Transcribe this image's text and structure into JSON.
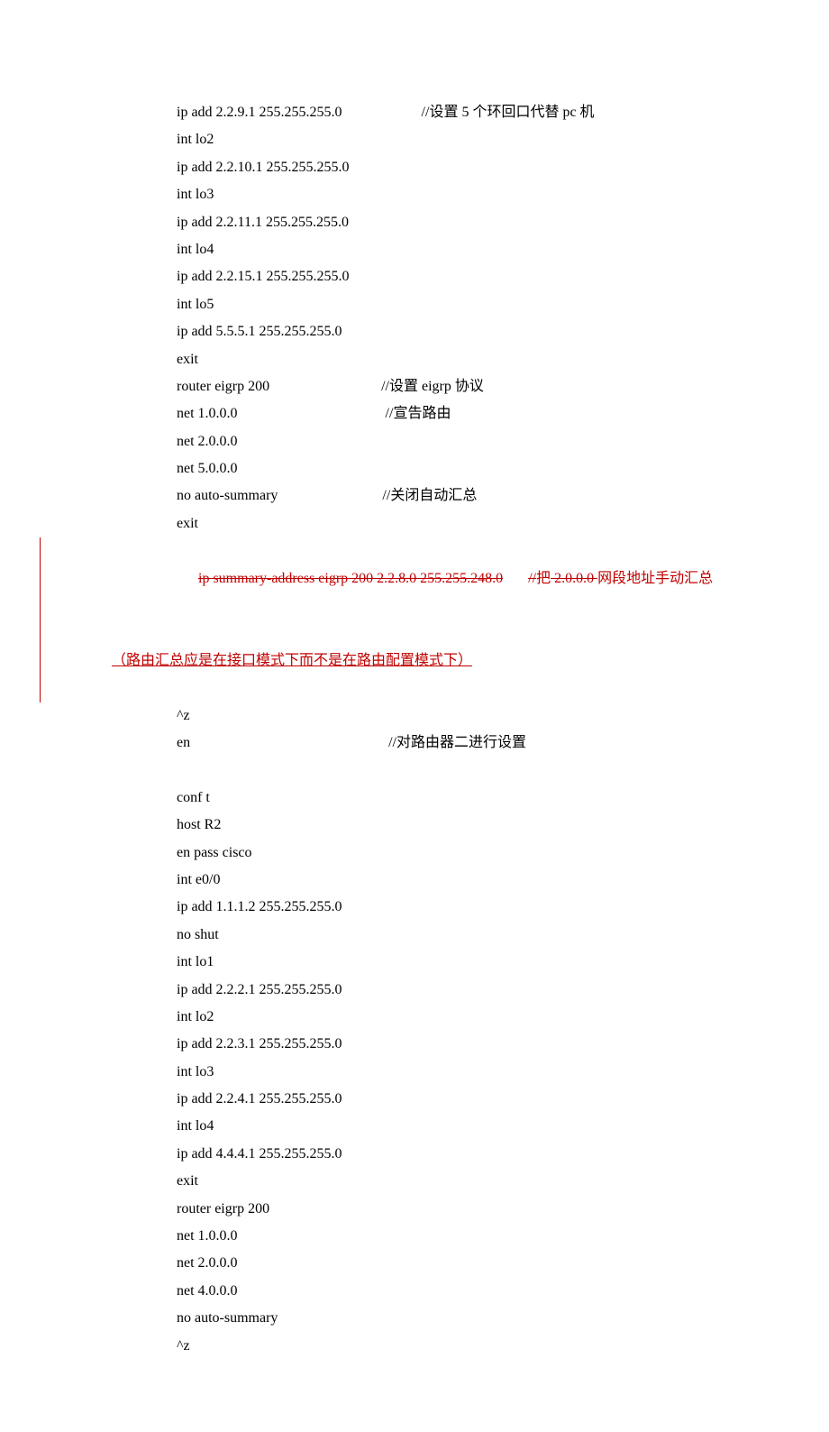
{
  "lines": [
    {
      "left": "ip add 2.2.9.1 255.255.255.0",
      "comment": "//设置 5 个环回口代替 pc 机"
    },
    {
      "left": "int lo2"
    },
    {
      "left": "ip add 2.2.10.1 255.255.255.0"
    },
    {
      "left": "int lo3"
    },
    {
      "left": "ip add 2.2.11.1 255.255.255.0"
    },
    {
      "left": "int lo4"
    },
    {
      "left": "ip add 2.2.15.1 255.255.255.0"
    },
    {
      "left": "int lo5"
    },
    {
      "left": "ip add 5.5.5.1 255.255.255.0"
    },
    {
      "left": "exit"
    },
    {
      "left": "router eigrp 200",
      "comment": "//设置 eigrp 协议",
      "gap": "                               "
    },
    {
      "left": "net 1.0.0.0",
      "comment": "//宣告路由",
      "gap": "                                         "
    },
    {
      "left": "net 2.0.0.0"
    },
    {
      "left": "net 5.0.0.0"
    },
    {
      "left": "no auto-summary",
      "comment": "//关闭自动汇总",
      "gap": "                             "
    },
    {
      "left": "exit"
    }
  ],
  "revision": {
    "strike_cmd": "ip summary-address eigrp 200 2.2.8.0 255.255.248.0",
    "strike_sep": "       ",
    "strike_pre": "//",
    "strike_mid": "把",
    "strike_seg": " 2.0.0.0 ",
    "strike_tail": "网段地址手动汇总",
    "underline": "（路由汇总应是在接口模式下而不是在路由配置模式下）"
  },
  "after": [
    {
      "left": "^z"
    },
    {
      "left": "en",
      "comment": "//对路由器二进行设置",
      "gap": "                                                       "
    },
    {
      "blank": true
    },
    {
      "left": "conf t"
    },
    {
      "left": "host R2"
    },
    {
      "left": "en pass cisco"
    },
    {
      "left": "int e0/0"
    },
    {
      "left": "ip add 1.1.1.2 255.255.255.0"
    },
    {
      "left": "no shut"
    },
    {
      "left": "int lo1"
    },
    {
      "left": "ip add 2.2.2.1 255.255.255.0"
    },
    {
      "left": "int lo2"
    },
    {
      "left": "ip add 2.2.3.1 255.255.255.0"
    },
    {
      "left": "int lo3"
    },
    {
      "left": "ip add 2.2.4.1 255.255.255.0"
    },
    {
      "left": "int lo4"
    },
    {
      "left": "ip add 4.4.4.1 255.255.255.0"
    },
    {
      "left": "exit"
    },
    {
      "left": "router eigrp 200"
    },
    {
      "left": "net 1.0.0.0"
    },
    {
      "left": "net 2.0.0.0"
    },
    {
      "left": "net 4.0.0.0"
    },
    {
      "left": "no auto-summary"
    },
    {
      "left": "^z"
    }
  ]
}
